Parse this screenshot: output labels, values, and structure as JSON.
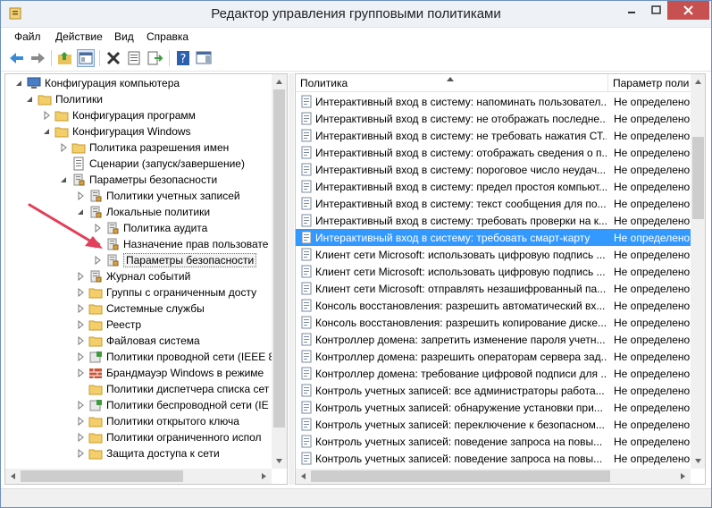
{
  "window": {
    "title": "Редактор управления групповыми политиками"
  },
  "menu": [
    {
      "id": "file",
      "label": "Файл"
    },
    {
      "id": "action",
      "label": "Действие"
    },
    {
      "id": "view",
      "label": "Вид"
    },
    {
      "id": "help",
      "label": "Справка"
    }
  ],
  "tree": [
    {
      "label": "Конфигурация компьютера",
      "level": 0,
      "expander": "open",
      "icon": "computer-icon"
    },
    {
      "label": "Политики",
      "level": 1,
      "expander": "open",
      "icon": "folder-icon"
    },
    {
      "label": "Конфигурация программ",
      "level": 2,
      "expander": "closed",
      "icon": "folder-icon"
    },
    {
      "label": "Конфигурация Windows",
      "level": 2,
      "expander": "open",
      "icon": "folder-icon"
    },
    {
      "label": "Политика разрешения имен",
      "level": 3,
      "expander": "closed",
      "icon": "folder-icon"
    },
    {
      "label": "Сценарии (запуск/завершение)",
      "level": 3,
      "expander": "none",
      "icon": "script-icon"
    },
    {
      "label": "Параметры безопасности",
      "level": 3,
      "expander": "open",
      "icon": "security-icon"
    },
    {
      "label": "Политики учетных записей",
      "level": 4,
      "expander": "closed",
      "icon": "security-icon"
    },
    {
      "label": "Локальные политики",
      "level": 4,
      "expander": "open",
      "icon": "security-icon"
    },
    {
      "label": "Политика аудита",
      "level": 5,
      "expander": "closed",
      "icon": "security-icon"
    },
    {
      "label": "Назначение прав пользовате",
      "level": 5,
      "expander": "closed",
      "icon": "security-icon"
    },
    {
      "label": "Параметры безопасности",
      "level": 5,
      "expander": "closed",
      "icon": "security-icon",
      "selected": true
    },
    {
      "label": "Журнал событий",
      "level": 4,
      "expander": "closed",
      "icon": "security-icon"
    },
    {
      "label": "Группы с ограниченным досту",
      "level": 4,
      "expander": "closed",
      "icon": "folder-icon"
    },
    {
      "label": "Системные службы",
      "level": 4,
      "expander": "closed",
      "icon": "folder-icon"
    },
    {
      "label": "Реестр",
      "level": 4,
      "expander": "closed",
      "icon": "folder-icon"
    },
    {
      "label": "Файловая система",
      "level": 4,
      "expander": "closed",
      "icon": "folder-icon"
    },
    {
      "label": "Политики проводной сети (IEEE 8",
      "level": 4,
      "expander": "closed",
      "icon": "network-icon"
    },
    {
      "label": "Брандмауэр Windows в режиме",
      "level": 4,
      "expander": "closed",
      "icon": "firewall-icon"
    },
    {
      "label": "Политики диспетчера списка сет",
      "level": 4,
      "expander": "none",
      "icon": "folder-icon"
    },
    {
      "label": "Политики беспроводной сети (IE",
      "level": 4,
      "expander": "closed",
      "icon": "network-icon"
    },
    {
      "label": "Политики открытого ключа",
      "level": 4,
      "expander": "closed",
      "icon": "folder-icon"
    },
    {
      "label": "Политики ограниченного испол",
      "level": 4,
      "expander": "closed",
      "icon": "folder-icon"
    },
    {
      "label": "Защита доступа к сети",
      "level": 4,
      "expander": "closed",
      "icon": "folder-icon"
    }
  ],
  "list": {
    "columns": [
      "Политика",
      "Параметр поли"
    ],
    "rows": [
      {
        "policy": "Интерактивный вход в систему: напоминать пользовател...",
        "value": "Не определено"
      },
      {
        "policy": "Интерактивный вход в систему: не отображать последне...",
        "value": "Не определено"
      },
      {
        "policy": "Интерактивный вход в систему: не требовать нажатия СТ...",
        "value": "Не определено"
      },
      {
        "policy": "Интерактивный вход в систему: отображать сведения о п...",
        "value": "Не определено"
      },
      {
        "policy": "Интерактивный вход в систему: пороговое число неудач...",
        "value": "Не определено"
      },
      {
        "policy": "Интерактивный вход в систему: предел простоя компьют...",
        "value": "Не определено"
      },
      {
        "policy": "Интерактивный вход в систему: текст сообщения для по...",
        "value": "Не определено"
      },
      {
        "policy": "Интерактивный вход в систему: требовать проверки на к...",
        "value": "Не определено"
      },
      {
        "policy": "Интерактивный вход в систему: требовать смарт-карту",
        "value": "Не определено",
        "selected": true
      },
      {
        "policy": "Клиент сети Microsoft: использовать цифровую подпись ...",
        "value": "Не определено"
      },
      {
        "policy": "Клиент сети Microsoft: использовать цифровую подпись ...",
        "value": "Не определено"
      },
      {
        "policy": "Клиент сети Microsoft: отправлять незашифрованный па...",
        "value": "Не определено"
      },
      {
        "policy": "Консоль восстановления: разрешить автоматический вх...",
        "value": "Не определено"
      },
      {
        "policy": "Консоль восстановления: разрешить копирование диске...",
        "value": "Не определено"
      },
      {
        "policy": "Контроллер домена: запретить изменение пароля учетн...",
        "value": "Не определено"
      },
      {
        "policy": "Контроллер домена: разрешить операторам сервера зад...",
        "value": "Не определено"
      },
      {
        "policy": "Контроллер домена: требование цифровой подписи для ...",
        "value": "Не определено"
      },
      {
        "policy": "Контроль учетных записей: все администраторы работа...",
        "value": "Не определено"
      },
      {
        "policy": "Контроль учетных записей: обнаружение установки при...",
        "value": "Не определено"
      },
      {
        "policy": "Контроль учетных записей: переключение к безопасном...",
        "value": "Не определено"
      },
      {
        "policy": "Контроль учетных записей: поведение запроса на повы...",
        "value": "Не определено"
      },
      {
        "policy": "Контроль учетных записей: поведение запроса на повы...",
        "value": "Не определено"
      }
    ]
  },
  "colors": {
    "selection": "#3399ff",
    "close": "#c75050",
    "arrow": "#e0405a"
  }
}
